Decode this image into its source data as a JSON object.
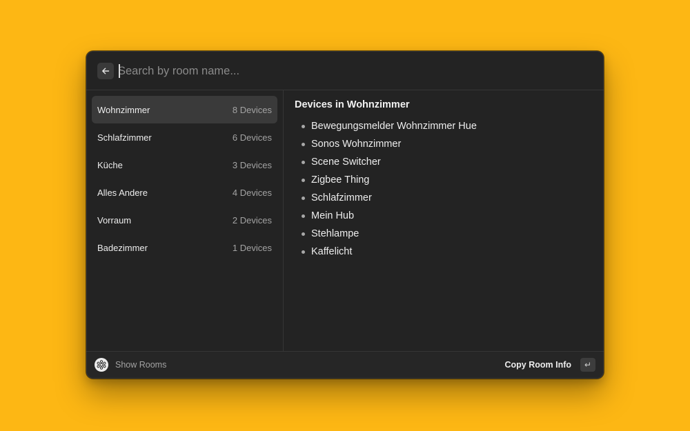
{
  "colors": {
    "background": "#FDB714",
    "window": "#232323",
    "selected_row": "#3A3A3A"
  },
  "search": {
    "placeholder": "Search by room name...",
    "back_icon": "arrow-left-icon"
  },
  "rooms": [
    {
      "name": "Wohnzimmer",
      "count": "8 Devices",
      "selected": true
    },
    {
      "name": "Schlafzimmer",
      "count": "6 Devices",
      "selected": false
    },
    {
      "name": "Küche",
      "count": "3 Devices",
      "selected": false
    },
    {
      "name": "Alles Andere",
      "count": "4 Devices",
      "selected": false
    },
    {
      "name": "Vorraum",
      "count": "2 Devices",
      "selected": false
    },
    {
      "name": "Badezimmer",
      "count": "1 Devices",
      "selected": false
    }
  ],
  "detail": {
    "title": "Devices in Wohnzimmer",
    "devices": [
      "Bewegungsmelder Wohnzimmer Hue",
      "Sonos Wohnzimmer",
      "Scene Switcher",
      "Zigbee Thing",
      "Schlafzimmer",
      "Mein Hub",
      "Stehlampe",
      "Kaffelicht"
    ]
  },
  "footer": {
    "icon": "hue-bridge-icon",
    "label": "Show Rooms",
    "action_label": "Copy Room Info",
    "action_key": "↵"
  }
}
